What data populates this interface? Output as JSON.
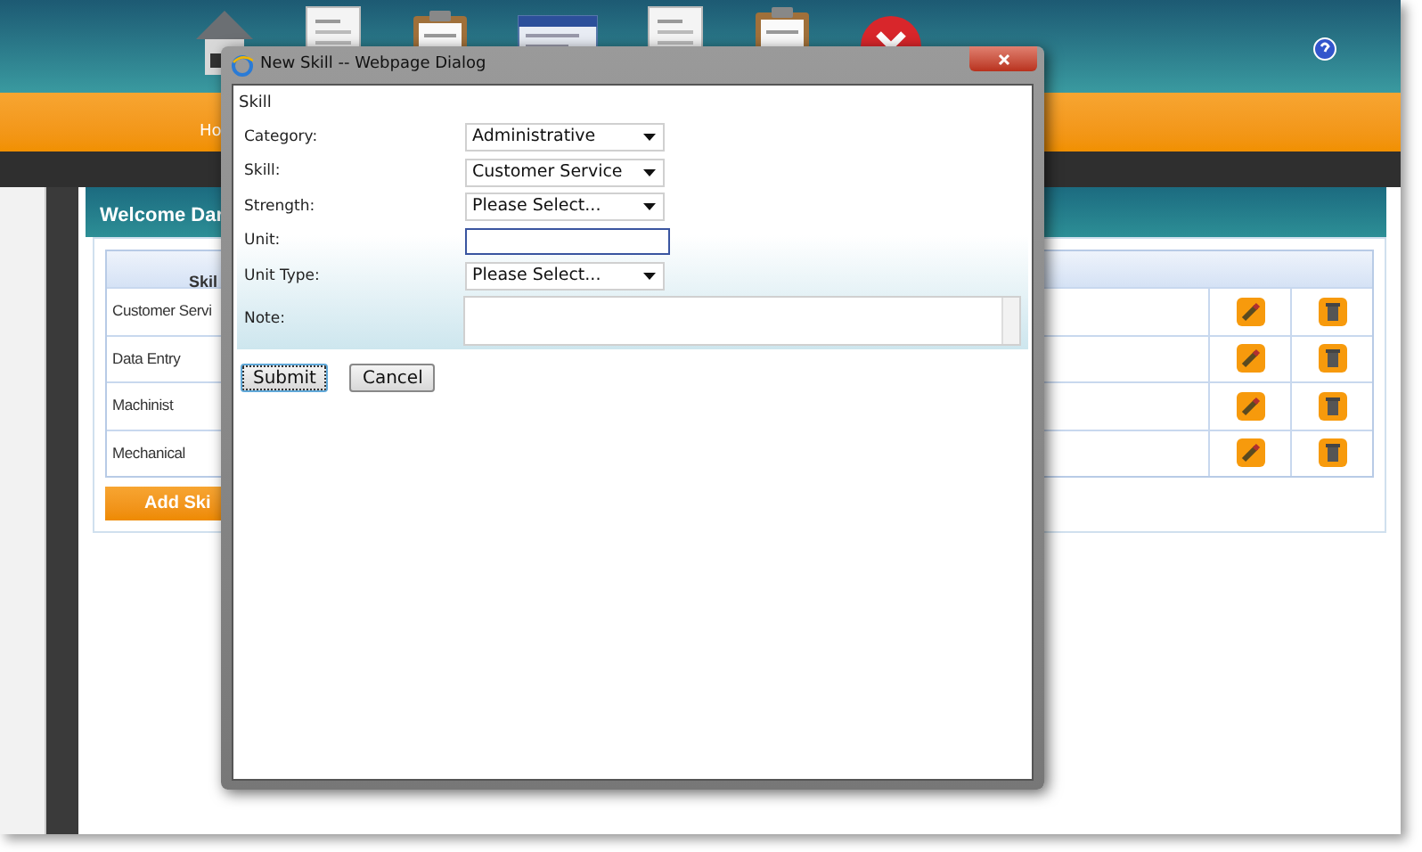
{
  "header": {
    "nav_label": "Ho"
  },
  "panel": {
    "title": "Welcome Dar",
    "table": {
      "columns": [
        {
          "label": "Skil"
        }
      ],
      "rows": [
        {
          "skill": "Customer Servi"
        },
        {
          "skill": "Data Entry"
        },
        {
          "skill": "Machinist"
        },
        {
          "skill": "Mechanical"
        }
      ]
    },
    "add_button": "Add Ski"
  },
  "dialog": {
    "title": "New Skill -- Webpage Dialog",
    "heading": "Skill",
    "fields": [
      {
        "label": "Category:",
        "kind": "select",
        "value": "Administrative",
        "focused": false
      },
      {
        "label": "Skill:",
        "kind": "select",
        "value": "Customer Service",
        "focused": false
      },
      {
        "label": "Strength:",
        "kind": "select",
        "value": "Please Select...",
        "focused": false
      },
      {
        "label": "Unit:",
        "kind": "text",
        "focused": true
      },
      {
        "label": "Unit Type:",
        "kind": "select",
        "value": "Please Select...",
        "focused": false
      },
      {
        "label": "Note:",
        "kind": "textarea",
        "focused": false
      }
    ],
    "buttons": [
      {
        "label": "Submit",
        "focused": true
      },
      {
        "label": "Cancel",
        "focused": false
      }
    ]
  }
}
